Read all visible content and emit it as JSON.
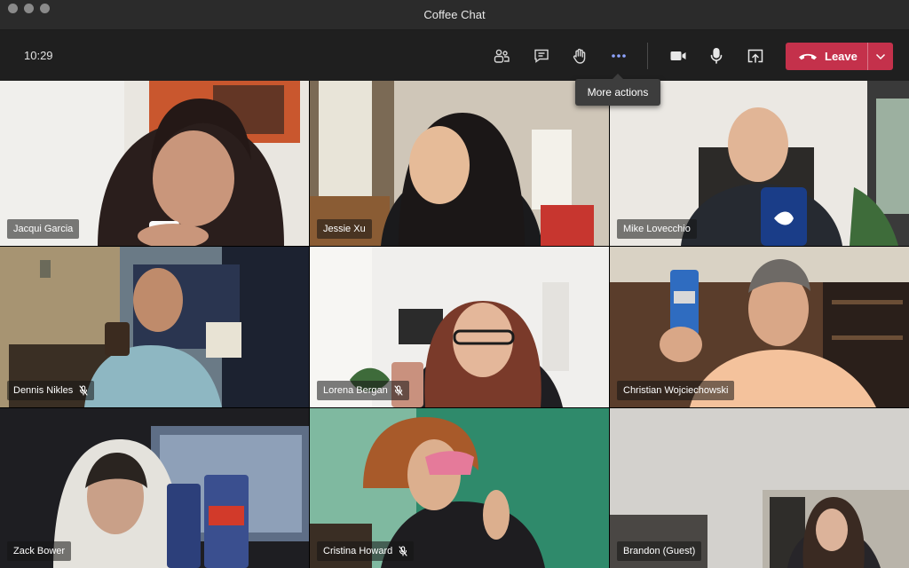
{
  "window": {
    "title": "Coffee Chat"
  },
  "toolbar": {
    "time": "10:29",
    "icons": [
      "participants-icon",
      "chat-icon",
      "raise-hand-icon",
      "more-actions-icon",
      "camera-icon",
      "microphone-icon",
      "share-screen-icon"
    ],
    "leave_label": "Leave"
  },
  "tooltip": {
    "text": "More actions"
  },
  "participants": [
    {
      "name": "Jacqui Garcia",
      "muted": false
    },
    {
      "name": "Jessie Xu",
      "muted": false
    },
    {
      "name": "Mike Lovecchio",
      "muted": false
    },
    {
      "name": "Dennis Nikles",
      "muted": true
    },
    {
      "name": "Lorena Bergan",
      "muted": true
    },
    {
      "name": "Christian Wojciechowski",
      "muted": false
    },
    {
      "name": "Zack Bower",
      "muted": false
    },
    {
      "name": "Cristina Howard",
      "muted": true
    },
    {
      "name": "Brandon (Guest)",
      "muted": false
    }
  ],
  "colors": {
    "leave": "#c4314b",
    "toolbar": "#1f1f1f",
    "titlebar": "#2b2b2b"
  }
}
